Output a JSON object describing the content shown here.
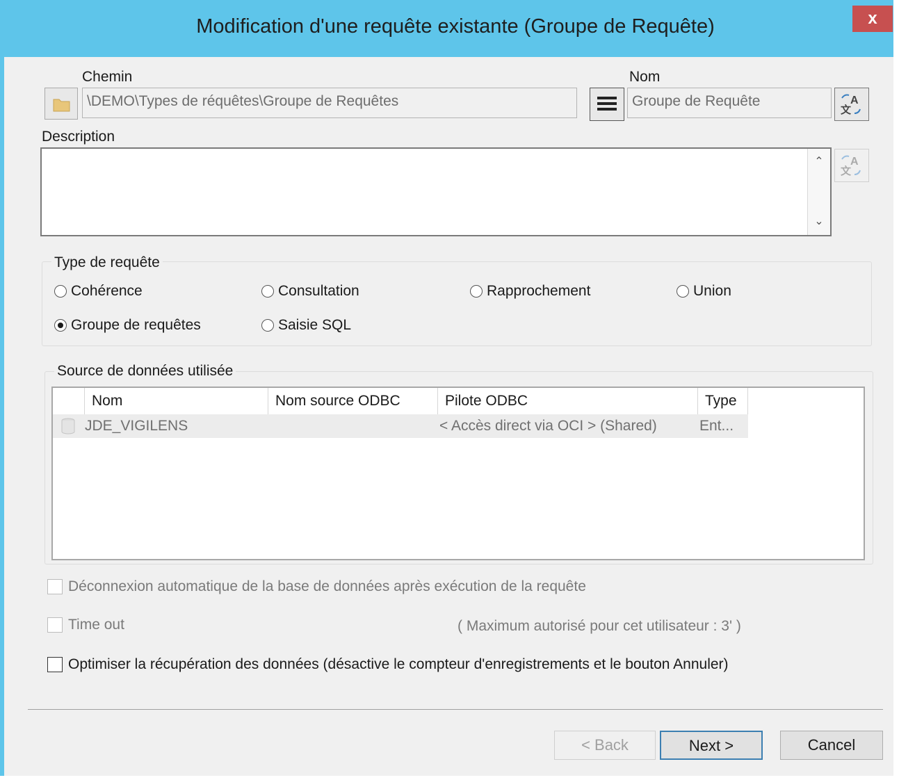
{
  "window": {
    "title": "Modification d'une requête existante (Groupe de Requête)",
    "close": "x"
  },
  "path": {
    "label": "Chemin",
    "value": "\\DEMO\\Types de réquêtes\\Groupe de Requêtes"
  },
  "name": {
    "label": "Nom",
    "value": "Groupe de Requête"
  },
  "description": {
    "label": "Description",
    "value": ""
  },
  "query_type": {
    "label": "Type de requête",
    "options": [
      {
        "label": "Cohérence",
        "selected": false
      },
      {
        "label": "Consultation",
        "selected": false
      },
      {
        "label": "Rapprochement",
        "selected": false
      },
      {
        "label": "Union",
        "selected": false
      },
      {
        "label": "Groupe de requêtes",
        "selected": true
      },
      {
        "label": "Saisie SQL",
        "selected": false
      }
    ]
  },
  "datasource": {
    "label": "Source de données utilisée",
    "columns": [
      "Nom",
      "Nom source ODBC",
      "Pilote ODBC",
      "Type"
    ],
    "rows": [
      {
        "name": "JDE_VIGILENS",
        "odbc_source": "",
        "driver": "< Accès direct via OCI > (Shared)",
        "type": "Ent..."
      }
    ]
  },
  "options": {
    "auto_disconnect": "Déconnexion automatique de la base de données après exécution de la requête",
    "timeout": "Time out",
    "timeout_max": "( Maximum autorisé pour cet utilisateur :   3' )",
    "optimize": "Optimiser la récupération des données (désactive le compteur d'enregistrements et le bouton Annuler)"
  },
  "buttons": {
    "back": "< Back",
    "next": "Next >",
    "cancel": "Cancel"
  },
  "colors": {
    "titlebar": "#5ec5ea",
    "close": "#c75050",
    "default_border": "#3c7fb1"
  }
}
